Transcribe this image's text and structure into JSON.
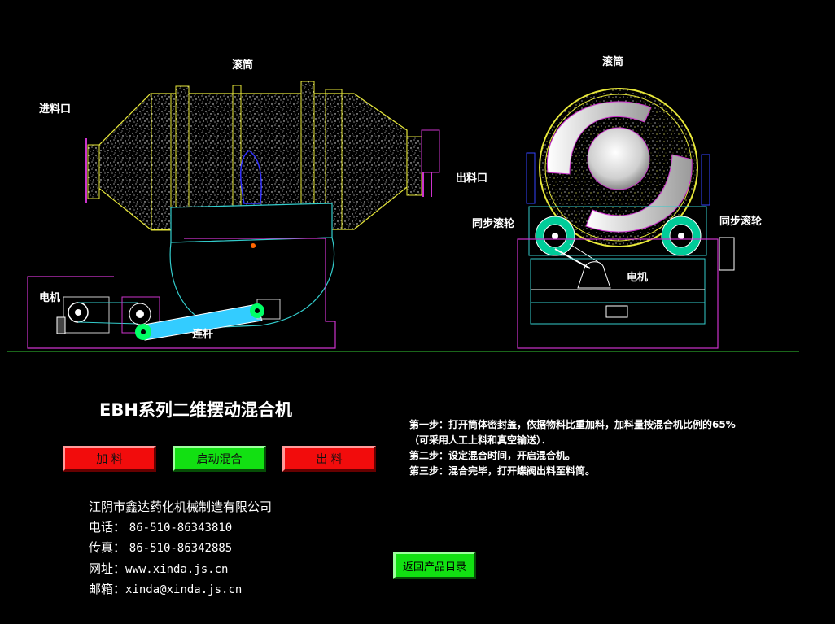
{
  "diagram": {
    "labels": {
      "drum_left": "滚筒",
      "drum_right": "滚筒",
      "inlet": "进料口",
      "outlet": "出料口",
      "sync_wheel_left": "同步滚轮",
      "sync_wheel_right": "同步滚轮",
      "motor_left": "电机",
      "motor_right": "电机",
      "link_rod": "连杆"
    }
  },
  "title": "EBH系列二维摆动混合机",
  "buttons": {
    "load": "加  料",
    "start": "启动混合",
    "unload": "出  料",
    "back": "返回产品目录"
  },
  "steps": [
    "第一步：打开筒体密封盖，依据物料比重加料，加料量按混合机比例的65%",
    "（可采用人工上料和真空输送）．",
    "第二步：设定混合时间，开启混合机。",
    "第三步：混合完毕，打开蝶阀出料至料筒。"
  ],
  "company": {
    "name": "江阴市鑫达药化机械制造有限公司",
    "phone_label": "电话：",
    "phone": "86-510-86343810",
    "fax_label": "传真：",
    "fax": "86-510-86342885",
    "web_label": "网址：",
    "web": "www.xinda.js.cn",
    "email_label": "邮箱：",
    "email": "xinda@xinda.js.cn"
  },
  "colors": {
    "drum_outline": "#e6e639",
    "frame": "#cc33cc",
    "base": "#33cccc",
    "rod": "#33ccff",
    "pivot": "#00ff66",
    "button_red": "#f20c0c",
    "button_green": "#12e012",
    "ground_line": "#33cc33"
  }
}
